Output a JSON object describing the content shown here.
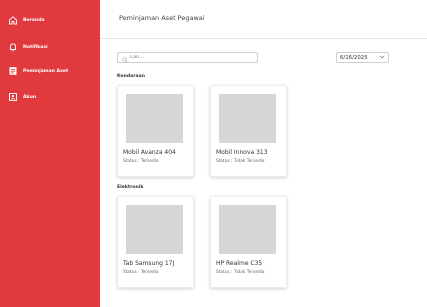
{
  "sidebar": {
    "items": [
      {
        "label": "Beranda",
        "icon": "home-icon"
      },
      {
        "label": "Notifikasi",
        "icon": "bell-icon"
      },
      {
        "label": "Peminjaman Aset",
        "icon": "asset-loan-icon"
      },
      {
        "label": "Akun",
        "icon": "account-icon"
      }
    ],
    "color": "#e03a3e"
  },
  "header": {
    "title": "Peminjaman Aset Pegawai"
  },
  "search": {
    "placeholder": "Cari..."
  },
  "date_filter": {
    "value": "6/16/2025"
  },
  "sections": [
    {
      "label": "Kendaraan",
      "items": [
        {
          "name": "Mobil Avanza 404",
          "status": "Status : Tersedia"
        },
        {
          "name": "Mobil Innova 313",
          "status": "Status : Tidak Tersedia"
        }
      ]
    },
    {
      "label": "Elektronik",
      "items": [
        {
          "name": "Tab Samsung 17J",
          "status": "Status : Tersedia"
        },
        {
          "name": "HP Realme C35",
          "status": "Status : Tidak Tersedia"
        }
      ]
    }
  ]
}
